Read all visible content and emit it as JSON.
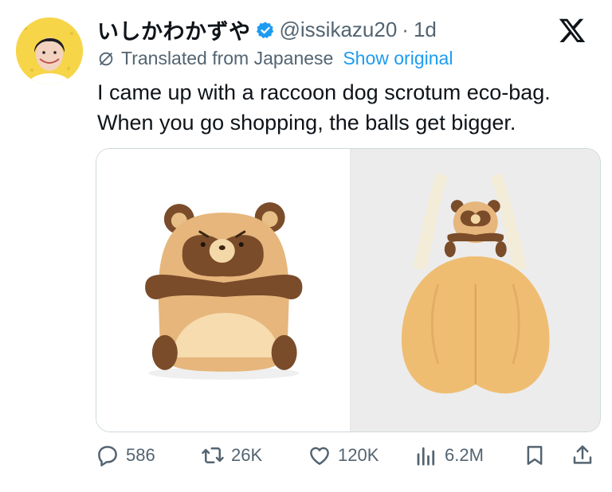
{
  "tweet": {
    "author": {
      "name": "いしかわかずや",
      "handle": "@issikazu20",
      "separator": "·",
      "time": "1d"
    },
    "translation": {
      "label": "Translated from Japanese",
      "show_original": "Show original"
    },
    "text_lines": [
      "I came up with a raccoon dog scrotum eco-bag.",
      "When you go shopping, the balls get bigger."
    ],
    "stats": {
      "replies": "586",
      "reposts": "26K",
      "likes": "120K",
      "views": "6.2M"
    }
  },
  "icons": [
    "verified-badge-icon",
    "x-logo-icon",
    "translate-icon",
    "reply-icon",
    "repost-icon",
    "like-icon",
    "views-icon",
    "bookmark-icon",
    "share-icon"
  ],
  "colors": {
    "accent": "#1d9bf0",
    "secondary_text": "#536471",
    "primary_text": "#0f1419",
    "avatar_bg": "#f6d548"
  }
}
